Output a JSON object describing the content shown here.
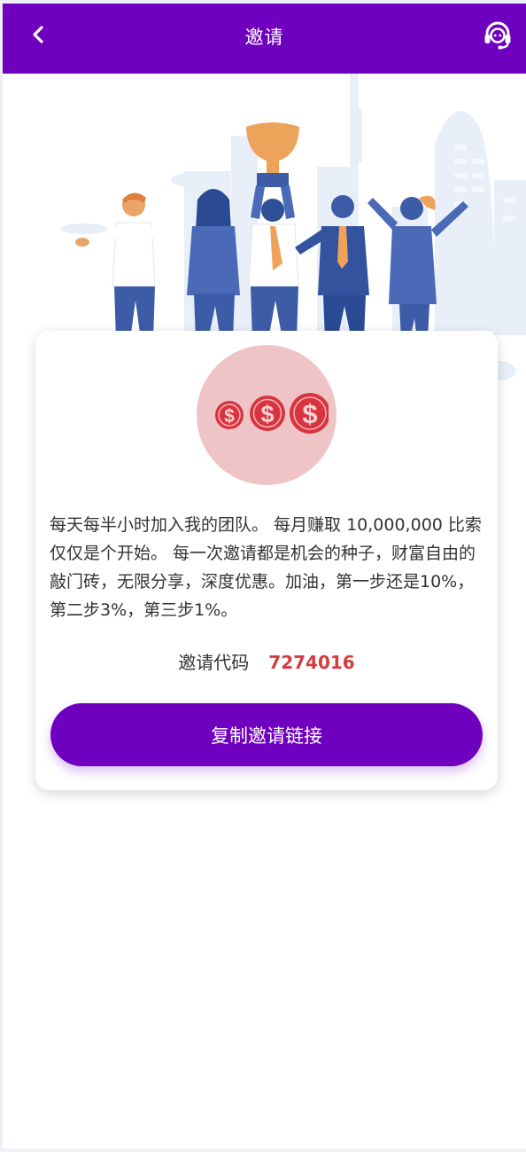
{
  "header": {
    "title": "邀请",
    "back_icon": "chevron-left-icon",
    "support_icon": "customer-service-headset-icon"
  },
  "hero": {
    "illustration": "celebrating-team-with-trophy"
  },
  "card": {
    "icon": "dollar-coins-icon",
    "description": "每天每半小时加入我的团队。 每月赚取 10,000,000 比索仅仅是个开始。 每一次邀请都是机会的种子，财富自由的敲门砖，无限分享，深度优惠。加油，第一步还是10%，第二步3%，第三步1%。",
    "code_label": "邀请代码",
    "code_value": "7274016",
    "copy_button_label": "复制邀请链接"
  },
  "colors": {
    "brand": "#7000bf",
    "code": "#d63a3f",
    "coin": "#d8343f",
    "coin_bg": "#efc4c6"
  }
}
